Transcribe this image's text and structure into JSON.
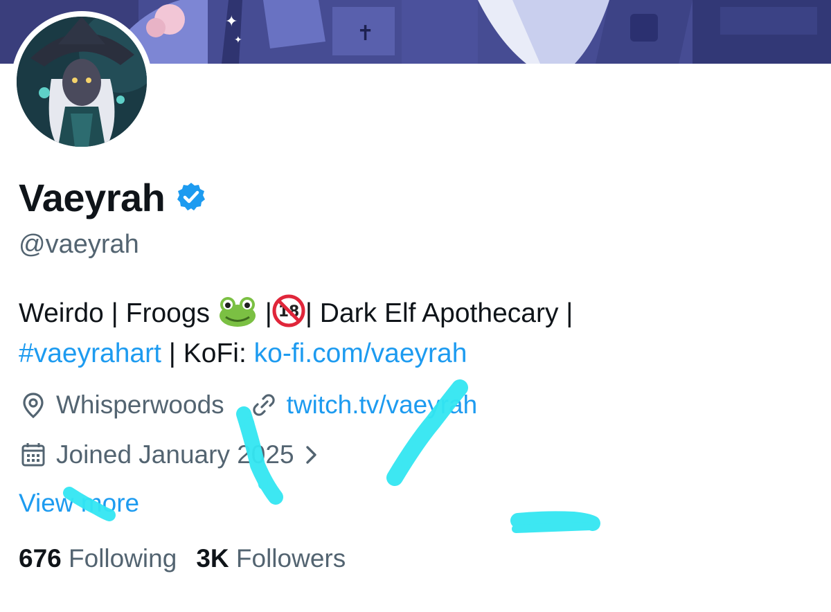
{
  "profile": {
    "display_name": "Vaeyrah",
    "verified": true,
    "handle": "@vaeyrah",
    "bio": {
      "segment_1": "Weirdo | Froogs ",
      "segment_2": " |",
      "segment_3": "| Dark Elf Apothecary |",
      "hashtag": "#vaeyrahart",
      "segment_4": " | KoFi: ",
      "kofi_link": "ko-fi.com/vaeyrah",
      "emoji_1": "frog-emoji",
      "emoji_2": "no-under-18-emoji"
    },
    "location": "Whisperwoods",
    "website": "twitch.tv/vaeyrah",
    "joined": "Joined January 2025",
    "view_more": "View more",
    "following_count": "676",
    "following_label": "Following",
    "followers_count": "3K",
    "followers_label": "Followers"
  },
  "icons": {
    "location": "location-pin-icon",
    "link": "link-icon",
    "calendar": "calendar-icon",
    "chevron": "chevron-right-icon",
    "verified": "verified-badge-icon"
  },
  "colors": {
    "link": "#1d9bf0",
    "secondary_text": "#536471",
    "primary_text": "#0f1419",
    "scribble": "#33e6f2"
  }
}
